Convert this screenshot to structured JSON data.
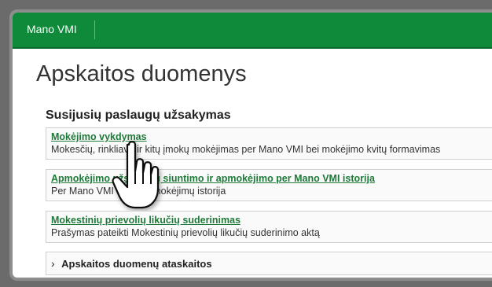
{
  "header": {
    "brand": "Mano VMI"
  },
  "page": {
    "title": "Apskaitos duomenys"
  },
  "section": {
    "title": "Susijusių paslaugų užsakymas",
    "items": [
      {
        "link": "Mokėjimo vykdymas",
        "description": "Mokesčių, rinkliavų ir kitų įmokų mokėjimas per Mano VMI bei mokėjimo kvitų formavimas"
      },
      {
        "link": "Apmokėjimo užsakymų siuntimo ir apmokėjimo per Mano VMI istorija",
        "description": "Per Mano VMI vykdytų mokėjimų istorija"
      },
      {
        "link": "Mokestinių prievolių likučių suderinimas",
        "description": "Prašymas pateikti Mokestinių prievolių likučių suderinimo aktą"
      }
    ],
    "collapsible": {
      "label": "Apskaitos duomenų ataskaitos"
    }
  },
  "cursor": {
    "icon": "hand-pointer-icon"
  }
}
